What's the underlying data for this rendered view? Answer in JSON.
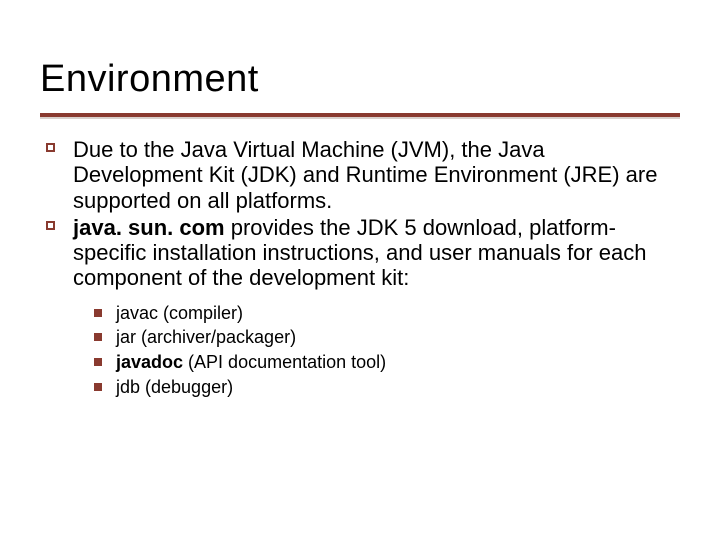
{
  "title": "Environment",
  "bullets": [
    {
      "text": "Due to the Java Virtual Machine (JVM), the Java Development Kit (JDK) and Runtime Environment (JRE) are supported on all platforms."
    },
    {
      "prefix_bold": "java. sun. com",
      "rest": " provides the JDK 5 download, platform-specific installation instructions, and user manuals for each component of the development kit:"
    }
  ],
  "sub_bullets": [
    {
      "text": "javac (compiler)"
    },
    {
      "text": "jar (archiver/packager)"
    },
    {
      "bold": "javadoc",
      "rest": " (API documentation tool)"
    },
    {
      "text": "jdb (debugger)"
    }
  ]
}
